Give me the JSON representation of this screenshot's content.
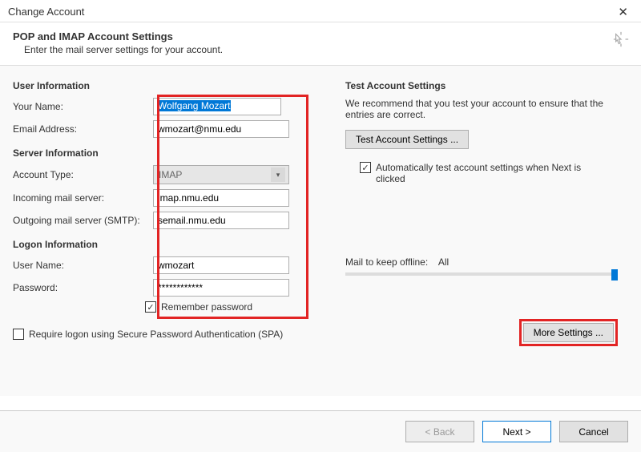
{
  "window": {
    "title": "Change Account"
  },
  "header": {
    "title": "POP and IMAP Account Settings",
    "subtitle": "Enter the mail server settings for your account."
  },
  "sections": {
    "user_info": "User Information",
    "server_info": "Server Information",
    "logon_info": "Logon Information",
    "test": "Test Account Settings"
  },
  "labels": {
    "your_name": "Your Name:",
    "email": "Email Address:",
    "account_type": "Account Type:",
    "incoming": "Incoming mail server:",
    "outgoing": "Outgoing mail server (SMTP):",
    "user_name": "User Name:",
    "password": "Password:",
    "remember": "Remember password",
    "spa": "Require logon using Secure Password Authentication (SPA)",
    "test_hint": "We recommend that you test your account to ensure that the entries are correct.",
    "test_btn": "Test Account Settings ...",
    "auto_test": "Automatically test account settings when Next is clicked",
    "mail_offline": "Mail to keep offline:",
    "mail_offline_val": "All",
    "more": "More Settings ...",
    "back": "< Back",
    "next": "Next >",
    "cancel": "Cancel"
  },
  "values": {
    "your_name": "Wolfgang Mozart",
    "email": "wmozart@nmu.edu",
    "account_type": "IMAP",
    "incoming": "imap.nmu.edu",
    "outgoing": "semail.nmu.edu",
    "user_name": "wmozart",
    "password": "************"
  },
  "checks": {
    "remember": true,
    "spa": false,
    "auto_test": true
  }
}
